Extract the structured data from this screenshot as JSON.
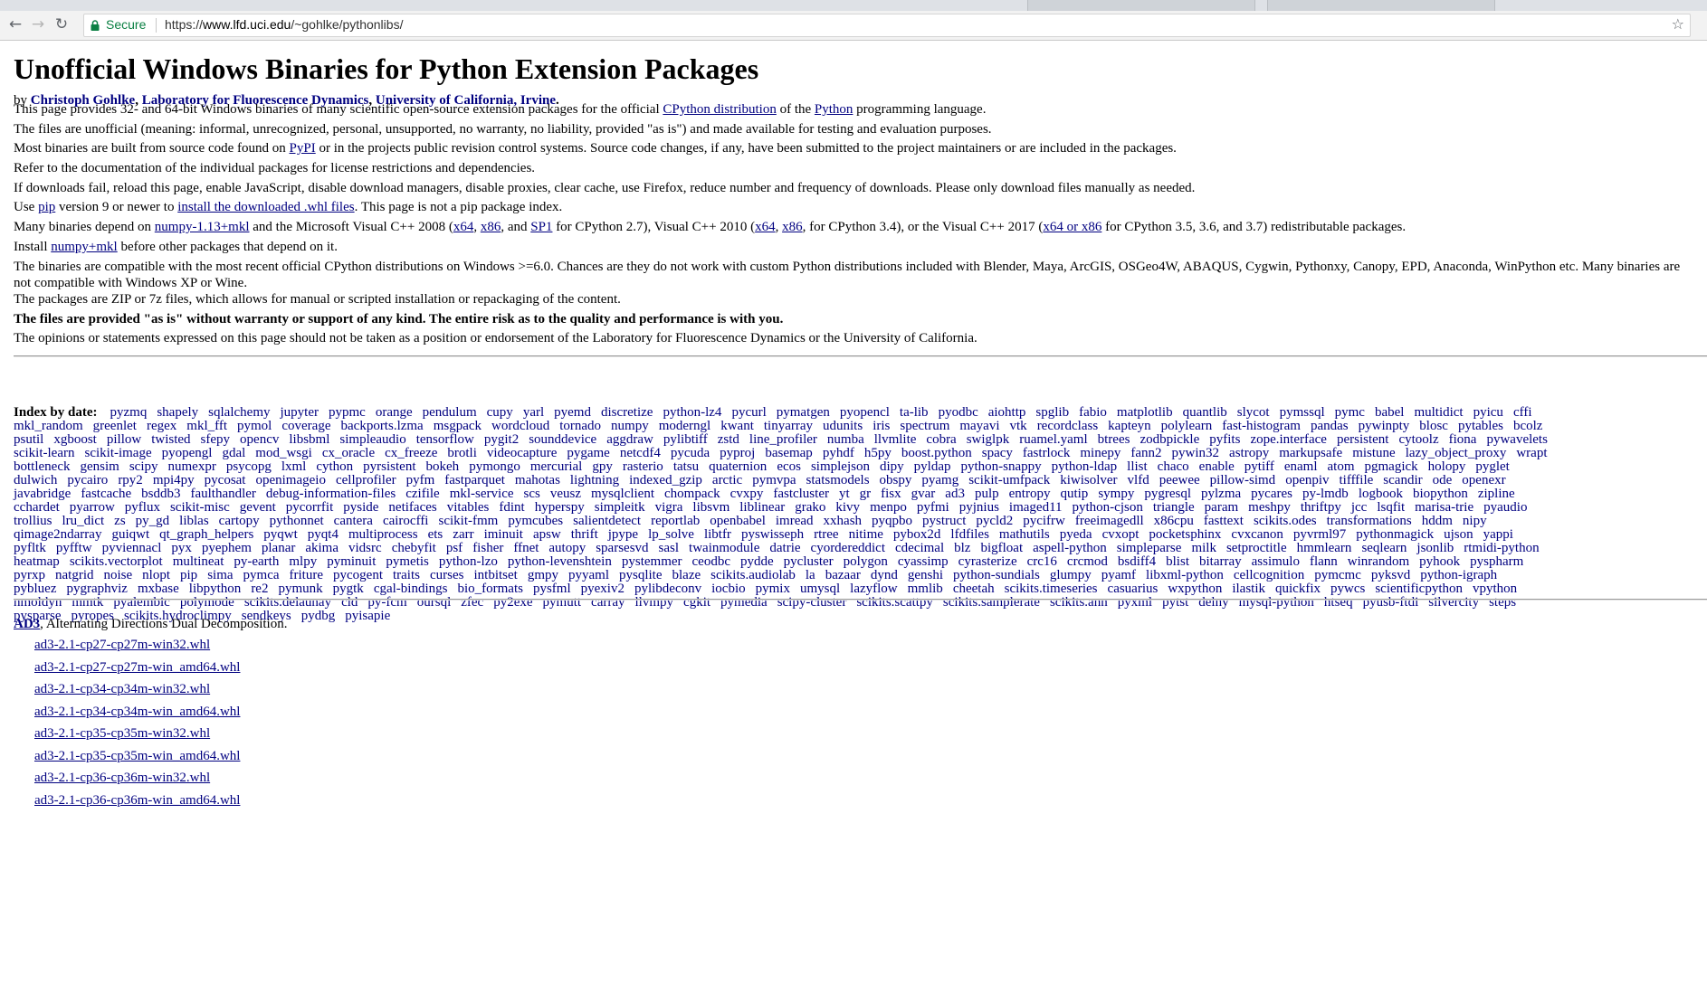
{
  "browser": {
    "secure_label": "Secure",
    "url_prefix": "https://",
    "url_host": "www.lfd.uci.edu",
    "url_path": "/~gohlke/pythonlibs/",
    "back_glyph": "←",
    "forward_glyph": "→",
    "reload_glyph": "↻",
    "star_glyph": "☆"
  },
  "page": {
    "title": "Unofficial Windows Binaries for Python Extension Packages",
    "byline": {
      "by": "by",
      "author": "Christoph Gohlke",
      "sep1": ", ",
      "lab": "Laboratory for Fluorescence Dynamics",
      "sep2": ", ",
      "university": "University of California, Irvine",
      "end": "."
    },
    "p1": {
      "a": "This page provides 32- and 64-bit Windows binaries of many scientific open-source extension packages for the official ",
      "link1": "CPython distribution",
      "b": " of the ",
      "link2": "Python",
      "c": " programming language."
    },
    "p2": "The files are unofficial (meaning: informal, unrecognized, personal, unsupported, no warranty, no liability, provided \"as is\") and made available for testing and evaluation purposes.",
    "p3": {
      "a": "Most binaries are built from source code found on ",
      "link": "PyPI",
      "b": " or in the projects public revision control systems. Source code changes, if any, have been submitted to the project maintainers or are included in the packages."
    },
    "p4": "Refer to the documentation of the individual packages for license restrictions and dependencies.",
    "p5": "If downloads fail, reload this page, enable JavaScript, disable download managers, disable proxies, clear cache, use Firefox, reduce number and frequency of downloads. Please only download files manually as needed.",
    "p6": {
      "a": "Use ",
      "link1": "pip",
      "b": " version 9 or newer to ",
      "link2": "install the downloaded .whl files",
      "c": ". This page is not a pip package index."
    },
    "p7": {
      "a": "Many binaries depend on ",
      "l1": "numpy-1.13+mkl",
      "b": " and the Microsoft Visual C++ 2008 (",
      "l2": "x64",
      "c": ", ",
      "l3": "x86",
      "d": ", and ",
      "l4": "SP1",
      "e": " for CPython 2.7), Visual C++ 2010 (",
      "l5": "x64",
      "f": ", ",
      "l6": "x86",
      "g": ", for CPython 3.4), or the Visual C++ 2017 (",
      "l7": "x64 or x86",
      "h": " for CPython 3.5, 3.6, and 3.7) redistributable packages."
    },
    "p8": {
      "a": "Install ",
      "link": "numpy+mkl",
      "b": " before other packages that depend on it."
    },
    "p9": "The binaries are compatible with the most recent official CPython distributions on Windows >=6.0. Chances are they do not work with custom Python distributions included with Blender, Maya, ArcGIS, OSGeo4W, ABAQUS, Cygwin, Pythonxy, Canopy, EPD, Anaconda, WinPython etc. Many binaries are not compatible with Windows XP or Wine.",
    "p10": "The packages are ZIP or 7z files, which allows for manual or scripted installation or repackaging of the content.",
    "p11": "The files are provided \"as is\" without warranty or support of any kind. The entire risk as to the quality and performance is with you.",
    "p12": "The opinions or statements expressed on this page should not be taken as a position or endorsement of the Laboratory for Fluorescence Dynamics or the University of California."
  },
  "index": {
    "label": "Index by date:",
    "lines": [
      [
        "pyzmq",
        "shapely",
        "sqlalchemy",
        "jupyter",
        "pypmc",
        "orange",
        "pendulum",
        "cupy",
        "yarl",
        "pyemd",
        "discretize",
        "python-lz4",
        "pycurl",
        "pymatgen",
        "pyopencl",
        "ta-lib",
        "pyodbc",
        "aiohttp",
        "spglib",
        "fabio",
        "matplotlib",
        "quantlib",
        "slycot",
        "pymssql",
        "pymc",
        "babel",
        "multidict",
        "pyicu",
        "cffi"
      ],
      [
        "mkl_random",
        "greenlet",
        "regex",
        "mkl_fft",
        "pymol",
        "coverage",
        "backports.lzma",
        "msgpack",
        "wordcloud",
        "tornado",
        "numpy",
        "moderngl",
        "kwant",
        "tinyarray",
        "udunits",
        "iris",
        "spectrum",
        "mayavi",
        "vtk",
        "recordclass",
        "kapteyn",
        "polylearn",
        "fast-histogram",
        "pandas",
        "pywinpty",
        "blosc",
        "pytables",
        "bcolz"
      ],
      [
        "psutil",
        "xgboost",
        "pillow",
        "twisted",
        "sfepy",
        "opencv",
        "libsbml",
        "simpleaudio",
        "tensorflow",
        "pygit2",
        "sounddevice",
        "aggdraw",
        "pylibtiff",
        "zstd",
        "line_profiler",
        "numba",
        "llvmlite",
        "cobra",
        "swiglpk",
        "ruamel.yaml",
        "btrees",
        "zodbpickle",
        "pyfits",
        "zope.interface",
        "persistent",
        "cytoolz",
        "fiona",
        "pywavelets"
      ],
      [
        "scikit-learn",
        "scikit-image",
        "pyopengl",
        "gdal",
        "mod_wsgi",
        "cx_oracle",
        "cx_freeze",
        "brotli",
        "videocapture",
        "pygame",
        "netcdf4",
        "pycuda",
        "pyproj",
        "basemap",
        "pyhdf",
        "h5py",
        "boost.python",
        "spacy",
        "fastrlock",
        "minepy",
        "fann2",
        "pywin32",
        "astropy",
        "markupsafe",
        "mistune",
        "lazy_object_proxy",
        "wrapt"
      ],
      [
        "bottleneck",
        "gensim",
        "scipy",
        "numexpr",
        "psycopg",
        "lxml",
        "cython",
        "pyrsistent",
        "bokeh",
        "pymongo",
        "mercurial",
        "gpy",
        "rasterio",
        "tatsu",
        "quaternion",
        "ecos",
        "simplejson",
        "dipy",
        "pyldap",
        "python-snappy",
        "python-ldap",
        "llist",
        "chaco",
        "enable",
        "pytiff",
        "enaml",
        "atom",
        "pgmagick",
        "holopy",
        "pyglet"
      ],
      [
        "dulwich",
        "pycairo",
        "rpy2",
        "mpi4py",
        "pycosat",
        "openimageio",
        "cellprofiler",
        "pyfm",
        "fastparquet",
        "mahotas",
        "lightning",
        "indexed_gzip",
        "arctic",
        "pymvpa",
        "statsmodels",
        "obspy",
        "pyamg",
        "scikit-umfpack",
        "kiwisolver",
        "vlfd",
        "peewee",
        "pillow-simd",
        "openpiv",
        "tifffile",
        "scandir",
        "ode",
        "openexr"
      ],
      [
        "javabridge",
        "fastcache",
        "bsddb3",
        "faulthandler",
        "debug-information-files",
        "czifile",
        "mkl-service",
        "scs",
        "veusz",
        "mysqlclient",
        "chompack",
        "cvxpy",
        "fastcluster",
        "yt",
        "gr",
        "fisx",
        "gvar",
        "ad3",
        "pulp",
        "entropy",
        "qutip",
        "sympy",
        "pygresql",
        "pylzma",
        "pycares",
        "py-lmdb",
        "logbook",
        "biopython",
        "zipline"
      ],
      [
        "cchardet",
        "pyarrow",
        "pyflux",
        "scikit-misc",
        "gevent",
        "pycorrfit",
        "pyside",
        "netifaces",
        "vitables",
        "fdint",
        "hyperspy",
        "simpleitk",
        "vigra",
        "libsvm",
        "liblinear",
        "grako",
        "kivy",
        "menpo",
        "pyfmi",
        "pyjnius",
        "imaged11",
        "python-cjson",
        "triangle",
        "param",
        "meshpy",
        "thriftpy",
        "jcc",
        "lsqfit",
        "marisa-trie",
        "pyaudio"
      ],
      [
        "trollius",
        "lru_dict",
        "zs",
        "py_gd",
        "liblas",
        "cartopy",
        "pythonnet",
        "cantera",
        "cairocffi",
        "scikit-fmm",
        "pymcubes",
        "salientdetect",
        "reportlab",
        "openbabel",
        "imread",
        "xxhash",
        "pyqpbo",
        "pystruct",
        "pycld2",
        "pycifrw",
        "freeimagedll",
        "x86cpu",
        "fasttext",
        "scikits.odes",
        "transformations",
        "hddm",
        "nipy"
      ],
      [
        "qimage2ndarray",
        "guiqwt",
        "qt_graph_helpers",
        "pyqwt",
        "pyqt4",
        "multiprocess",
        "ets",
        "zarr",
        "iminuit",
        "apsw",
        "thrift",
        "jpype",
        "lp_solve",
        "libtfr",
        "pyswisseph",
        "rtree",
        "nitime",
        "pybox2d",
        "lfdfiles",
        "mathutils",
        "pyeda",
        "cvxopt",
        "pocketsphinx",
        "cvxcanon",
        "pyvrml97",
        "pythonmagick",
        "ujson",
        "yappi"
      ],
      [
        "pyfltk",
        "pyfftw",
        "pyviennacl",
        "pyx",
        "pyephem",
        "planar",
        "akima",
        "vidsrc",
        "chebyfit",
        "psf",
        "fisher",
        "ffnet",
        "autopy",
        "sparsesvd",
        "sasl",
        "twainmodule",
        "datrie",
        "cyordereddict",
        "cdecimal",
        "blz",
        "bigfloat",
        "aspell-python",
        "simpleparse",
        "milk",
        "setproctitle",
        "hmmlearn",
        "seqlearn",
        "jsonlib",
        "rtmidi-python"
      ],
      [
        "heatmap",
        "scikits.vectorplot",
        "multineat",
        "py-earth",
        "mlpy",
        "pyminuit",
        "pymetis",
        "python-lzo",
        "python-levenshtein",
        "pystemmer",
        "ceodbc",
        "pydde",
        "pycluster",
        "polygon",
        "cyassimp",
        "cyrasterize",
        "crc16",
        "crcmod",
        "bsdiff4",
        "blist",
        "bitarray",
        "assimulo",
        "flann",
        "winrandom",
        "pyhook",
        "pyspharm"
      ],
      [
        "pyrxp",
        "natgrid",
        "noise",
        "nlopt",
        "pip",
        "sima",
        "pymca",
        "friture",
        "pycogent",
        "traits",
        "curses",
        "intbitset",
        "gmpy",
        "pyyaml",
        "pysqlite",
        "blaze",
        "scikits.audiolab",
        "la",
        "bazaar",
        "dynd",
        "genshi",
        "python-sundials",
        "glumpy",
        "pyamf",
        "libxml-python",
        "cellcognition",
        "pymcmc",
        "pyksvd",
        "python-igraph"
      ],
      [
        "pybluez",
        "pygraphviz",
        "mxbase",
        "libpython",
        "re2",
        "pymunk",
        "pygtk",
        "cgal-bindings",
        "bio_formats",
        "pysfml",
        "pyexiv2",
        "pylibdeconv",
        "iocbio",
        "pymix",
        "umysql",
        "lazyflow",
        "mmlib",
        "cheetah",
        "scikits.timeseries",
        "casuarius",
        "wxpython",
        "ilastik",
        "quickfix",
        "pywcs",
        "scientificpython",
        "vpython"
      ],
      [
        "nmoldyn",
        "mmtk",
        "pyalembic",
        "polymode",
        "scikits.delaunay",
        "cld",
        "py-fcm",
        "oursql",
        "zfec",
        "py2exe",
        "pymutt",
        "carray",
        "llvmpy",
        "cgkit",
        "pymedia",
        "scipy-cluster",
        "scikits.scattpy",
        "scikits.samplerate",
        "scikits.ann",
        "pyxml",
        "pytst",
        "delny",
        "mysql-python",
        "htseq",
        "pyusb-ftdi",
        "silvercity",
        "steps"
      ],
      [
        "pysparse",
        "pyropes",
        "scikits.hydroclimpy",
        "sendkeys",
        "pydbg",
        "pyisapie"
      ]
    ]
  },
  "package": {
    "name": "AD3",
    "description": ", Alternating Directions Dual Decomposition.",
    "files": [
      "ad3-2.1-cp27-cp27m-win32.whl",
      "ad3-2.1-cp27-cp27m-win_amd64.whl",
      "ad3-2.1-cp34-cp34m-win32.whl",
      "ad3-2.1-cp34-cp34m-win_amd64.whl",
      "ad3-2.1-cp35-cp35m-win32.whl",
      "ad3-2.1-cp35-cp35m-win_amd64.whl",
      "ad3-2.1-cp36-cp36m-win32.whl",
      "ad3-2.1-cp36-cp36m-win_amd64.whl"
    ]
  }
}
